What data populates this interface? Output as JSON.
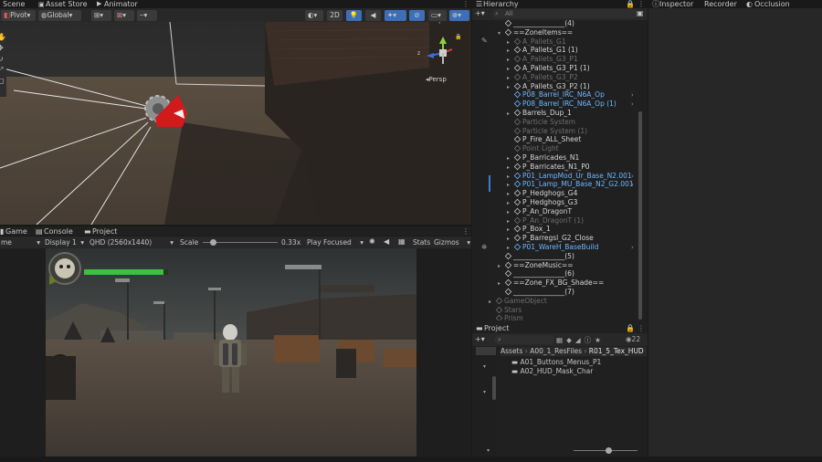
{
  "scene_panel": {
    "tabs": [
      "Scene",
      "Asset Store",
      "Animator"
    ],
    "toolbar": {
      "pivot": "Pivot",
      "global": "Global",
      "mode_2d": "2D"
    },
    "projection": "Persp",
    "gizmo_axes": {
      "x": "x",
      "y": "y",
      "z": "z"
    }
  },
  "game_panel": {
    "tabs": [
      "Game",
      "Console",
      "Project"
    ],
    "toolbar": {
      "mode": "me",
      "display": "Display 1",
      "resolution": "QHD (2560x1440)",
      "scale_label": "Scale",
      "scale_value": 0.33,
      "scale_text": "0.33x",
      "play_focused": "Play Focused",
      "stats": "Stats",
      "gizmos": "Gizmos"
    },
    "health_fraction": 0.95
  },
  "hierarchy": {
    "title": "Hierarchy",
    "search_placeholder": "All",
    "items": [
      {
        "label": "_______________(4)",
        "color": "white",
        "indent": 1,
        "arrow": ""
      },
      {
        "label": "==ZoneItems==",
        "color": "white",
        "indent": 1,
        "arrow": "▾"
      },
      {
        "label": "A_Pallets_G1",
        "color": "dim",
        "indent": 2,
        "arrow": "▸"
      },
      {
        "label": "A_Pallets_G1 (1)",
        "color": "white",
        "indent": 2,
        "arrow": "▸"
      },
      {
        "label": "A_Pallets_G3_P1",
        "color": "dim",
        "indent": 2,
        "arrow": "▸"
      },
      {
        "label": "A_Pallets_G3_P1 (1)",
        "color": "white",
        "indent": 2,
        "arrow": "▸"
      },
      {
        "label": "A_Pallets_G3_P2",
        "color": "dim",
        "indent": 2,
        "arrow": "▸"
      },
      {
        "label": "A_Pallets_G3_P2 (1)",
        "color": "white",
        "indent": 2,
        "arrow": "▸"
      },
      {
        "label": "P08_Barrel_IRC_N6A_Op",
        "color": "blue",
        "indent": 2,
        "arrow": "",
        "more": true
      },
      {
        "label": "P08_Barrel_IRC_N6A_Op (1)",
        "color": "blue",
        "indent": 2,
        "arrow": "",
        "more": true
      },
      {
        "label": "Barrels_Dup_1",
        "color": "white",
        "indent": 2,
        "arrow": "▸"
      },
      {
        "label": "Particle System",
        "color": "dim",
        "indent": 2,
        "arrow": ""
      },
      {
        "label": "Particle System (1)",
        "color": "dim",
        "indent": 2,
        "arrow": ""
      },
      {
        "label": "P_Fire_ALL_Sheet",
        "color": "white",
        "indent": 2,
        "arrow": ""
      },
      {
        "label": "Point Light",
        "color": "dim",
        "indent": 2,
        "arrow": ""
      },
      {
        "label": "P_Barricades_N1",
        "color": "white",
        "indent": 2,
        "arrow": "▸"
      },
      {
        "label": "P_Barricates_N1_P0",
        "color": "white",
        "indent": 2,
        "arrow": "▸"
      },
      {
        "label": "P01_LampMod_Ur_Base_N2.001",
        "color": "blue",
        "indent": 2,
        "arrow": "▸",
        "more": true
      },
      {
        "label": "P01_Lamp_MU_Base_N2_G2.001",
        "color": "blue",
        "indent": 2,
        "arrow": "▸",
        "more": true
      },
      {
        "label": "P_Hedghogs_G4",
        "color": "white",
        "indent": 2,
        "arrow": "▸"
      },
      {
        "label": "P_Hedghogs_G3",
        "color": "white",
        "indent": 2,
        "arrow": "▸"
      },
      {
        "label": "P_An_DragonT",
        "color": "white",
        "indent": 2,
        "arrow": "▸"
      },
      {
        "label": "P_An_DragonT (1)",
        "color": "dim",
        "indent": 2,
        "arrow": "▸"
      },
      {
        "label": "P_Box_1",
        "color": "white",
        "indent": 2,
        "arrow": "▸"
      },
      {
        "label": "P_Barregsl_G2_Close",
        "color": "white",
        "indent": 2,
        "arrow": "▸"
      },
      {
        "label": "P01_WareH_BaseBuild",
        "color": "blue",
        "indent": 2,
        "arrow": "▸",
        "more": true
      },
      {
        "label": "_______________(5)",
        "color": "white",
        "indent": 1,
        "arrow": ""
      },
      {
        "label": "==ZoneMusic==",
        "color": "white",
        "indent": 1,
        "arrow": "▸"
      },
      {
        "label": "_______________(6)",
        "color": "white",
        "indent": 1,
        "arrow": ""
      },
      {
        "label": "==Zone_FX_BG_Shade==",
        "color": "white",
        "indent": 1,
        "arrow": "▸"
      },
      {
        "label": "_______________(7)",
        "color": "white",
        "indent": 1,
        "arrow": ""
      },
      {
        "label": "GameObject",
        "color": "dim",
        "indent": 0,
        "arrow": "▸"
      },
      {
        "label": "Stars",
        "color": "dim",
        "indent": 0,
        "arrow": ""
      },
      {
        "label": "Prism",
        "color": "dim",
        "indent": 0,
        "arrow": ""
      }
    ]
  },
  "project": {
    "title": "Project",
    "badge_count": "22",
    "breadcrumb": [
      "Assets",
      "A00_1_ResFiles",
      "R01_5_Tex_HUD"
    ],
    "folders": [
      "A01_Buttons_Menus_P1",
      "A02_HUD_Mask_Char"
    ]
  },
  "right_tabs": [
    "Inspector",
    "Recorder",
    "Occlusion"
  ],
  "colors": {
    "accent_blue": "#3d7ad6",
    "prefab_blue": "#6fb6ff",
    "health_green": "#3fbf3f",
    "gizmo_red": "#d21a1a"
  }
}
